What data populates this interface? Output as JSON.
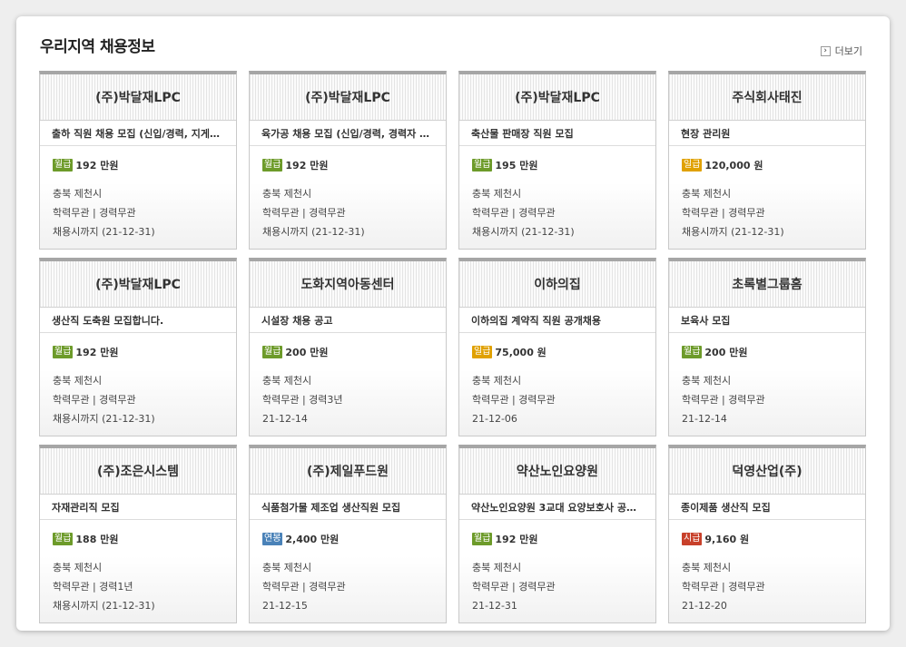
{
  "section": {
    "title": "우리지역 채용정보",
    "more_label": "더보기"
  },
  "badge_colors": {
    "월급": "#6d9b2a",
    "일급": "#e0a100",
    "연봉": "#4a82b8",
    "시급": "#c8402a"
  },
  "jobs": [
    {
      "company": "(주)박달재LPC",
      "title": "출하 직원 채용 모집 (신입/경력, 지게…",
      "pay_type": "월급",
      "pay": "192 만원",
      "location": "충북 제천시",
      "requirements": "학력무관 | 경력무관",
      "deadline": "채용시까지 (21-12-31)"
    },
    {
      "company": "(주)박달재LPC",
      "title": "육가공 채용 모집 (신입/경력, 경력자 …",
      "pay_type": "월급",
      "pay": "192 만원",
      "location": "충북 제천시",
      "requirements": "학력무관 | 경력무관",
      "deadline": "채용시까지 (21-12-31)"
    },
    {
      "company": "(주)박달재LPC",
      "title": "축산물 판매장 직원 모집",
      "pay_type": "월급",
      "pay": "195 만원",
      "location": "충북 제천시",
      "requirements": "학력무관 | 경력무관",
      "deadline": "채용시까지 (21-12-31)"
    },
    {
      "company": "주식회사태진",
      "title": "현장 관리원",
      "pay_type": "일급",
      "pay": "120,000 원",
      "location": "충북 제천시",
      "requirements": "학력무관 | 경력무관",
      "deadline": "채용시까지 (21-12-31)"
    },
    {
      "company": "(주)박달재LPC",
      "title": "생산직 도축원 모집합니다.",
      "pay_type": "월급",
      "pay": "192 만원",
      "location": "충북 제천시",
      "requirements": "학력무관 | 경력무관",
      "deadline": "채용시까지 (21-12-31)"
    },
    {
      "company": "도화지역아동센터",
      "title": "시설장 채용 공고",
      "pay_type": "월급",
      "pay": "200 만원",
      "location": "충북 제천시",
      "requirements": "학력무관 | 경력3년",
      "deadline": "21-12-14"
    },
    {
      "company": "이하의집",
      "title": "이하의집 계약직 직원 공개채용",
      "pay_type": "일급",
      "pay": "75,000 원",
      "location": "충북 제천시",
      "requirements": "학력무관 | 경력무관",
      "deadline": "21-12-06"
    },
    {
      "company": "초록별그룹홈",
      "title": "보육사 모집",
      "pay_type": "월급",
      "pay": "200 만원",
      "location": "충북 제천시",
      "requirements": "학력무관 | 경력무관",
      "deadline": "21-12-14"
    },
    {
      "company": "(주)조은시스템",
      "title": "자재관리직 모집",
      "pay_type": "월급",
      "pay": "188 만원",
      "location": "충북 제천시",
      "requirements": "학력무관 | 경력1년",
      "deadline": "채용시까지 (21-12-31)"
    },
    {
      "company": "(주)제일푸드원",
      "title": "식품첨가물 제조업 생산직원 모집",
      "pay_type": "연봉",
      "pay": "2,400 만원",
      "location": "충북 제천시",
      "requirements": "학력무관 | 경력무관",
      "deadline": "21-12-15"
    },
    {
      "company": "약산노인요양원",
      "title": "약산노인요양원 3교대 요양보호사 공…",
      "pay_type": "월급",
      "pay": "192 만원",
      "location": "충북 제천시",
      "requirements": "학력무관 | 경력무관",
      "deadline": "21-12-31"
    },
    {
      "company": "덕영산업(주)",
      "title": "종이제품 생산직 모집",
      "pay_type": "시급",
      "pay": "9,160 원",
      "location": "충북 제천시",
      "requirements": "학력무관 | 경력무관",
      "deadline": "21-12-20"
    }
  ]
}
